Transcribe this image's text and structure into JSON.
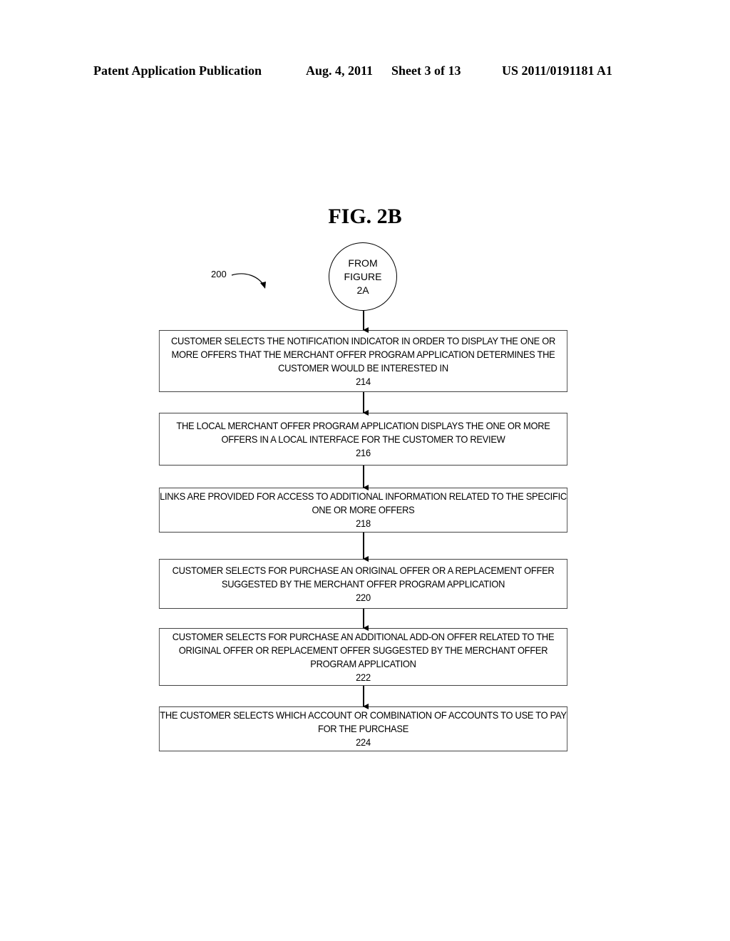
{
  "header": {
    "publication": "Patent Application Publication",
    "date": "Aug. 4, 2011",
    "sheet": "Sheet 3 of 13",
    "number": "US 2011/0191181 A1"
  },
  "figure": {
    "title": "FIG. 2B",
    "reference_label": "200",
    "connector": {
      "lines": [
        "FROM",
        "FIGURE",
        "2A"
      ]
    },
    "steps": [
      {
        "text": "CUSTOMER SELECTS THE NOTIFICATION INDICATOR IN ORDER TO DISPLAY THE ONE OR\nMORE OFFERS THAT THE MERCHANT OFFER PROGRAM APPLICATION DETERMINES THE\nCUSTOMER WOULD BE INTERESTED IN",
        "number": "214"
      },
      {
        "text": "THE LOCAL MERCHANT OFFER PROGRAM APPLICATION DISPLAYS THE ONE OR MORE\nOFFERS IN A LOCAL INTERFACE FOR THE CUSTOMER TO REVIEW",
        "number": "216"
      },
      {
        "text": "LINKS ARE PROVIDED FOR ACCESS TO ADDITIONAL INFORMATION RELATED TO THE SPECIFIC\nONE OR MORE OFFERS",
        "number": "218"
      },
      {
        "text": "CUSTOMER SELECTS FOR PURCHASE AN ORIGINAL OFFER OR A REPLACEMENT OFFER\nSUGGESTED BY THE MERCHANT OFFER PROGRAM APPLICATION",
        "number": "220"
      },
      {
        "text": "CUSTOMER SELECTS FOR PURCHASE AN ADDITIONAL ADD-ON OFFER RELATED TO THE\nORIGINAL OFFER OR REPLACEMENT OFFER SUGGESTED BY THE MERCHANT OFFER\nPROGRAM APPLICATION",
        "number": "222"
      },
      {
        "text": "THE CUSTOMER SELECTS WHICH ACCOUNT OR COMBINATION OF ACCOUNTS TO USE TO PAY\nFOR THE PURCHASE",
        "number": "224"
      }
    ]
  }
}
